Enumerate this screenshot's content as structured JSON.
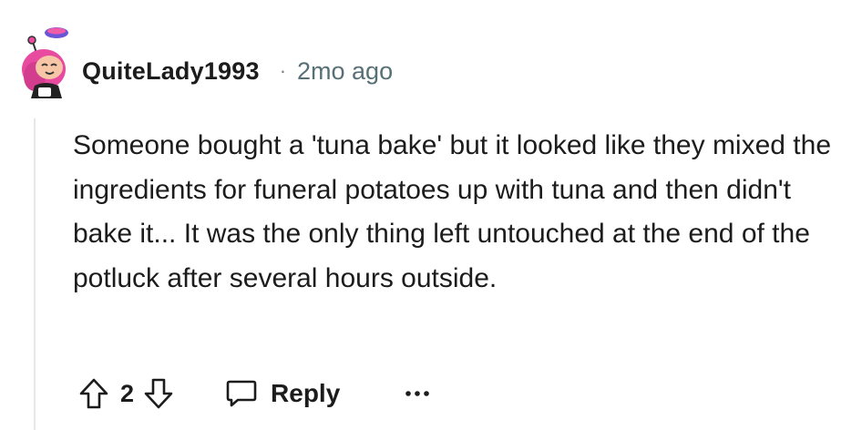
{
  "comment": {
    "username": "QuiteLady1993",
    "separator": "·",
    "timestamp": "2mo ago",
    "text": "Someone bought a 'tuna bake' but it looked like they mixed the ingredients for funeral potatoes up with tuna and then didn't bake it... It was the only thing left untouched at the end of the potluck after several hours outside.",
    "vote_count": "2",
    "reply_label": "Reply",
    "more_label": "..."
  },
  "icons": {
    "upvote": "upvote-arrow-icon",
    "downvote": "downvote-arrow-icon",
    "reply": "speech-bubble-icon",
    "more": "ellipsis-icon"
  },
  "colors": {
    "avatar_hair": "#e84aa0",
    "avatar_bow": "#6a55d8",
    "text": "#1c1c1c",
    "meta": "#576f76",
    "thread_line": "#e5e8ea"
  }
}
